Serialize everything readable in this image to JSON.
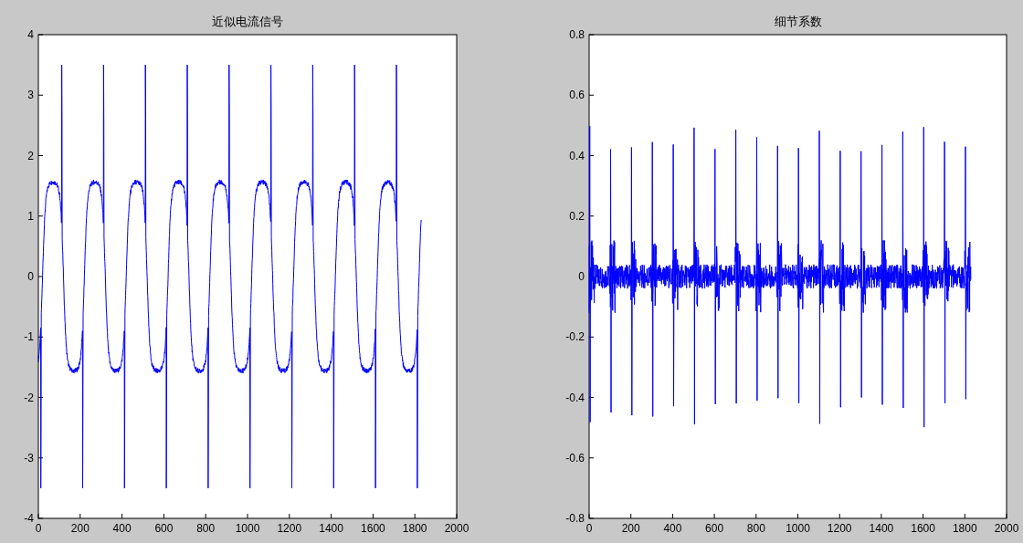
{
  "plots": [
    {
      "kind": "approx",
      "title": "近似电流信号",
      "xticks": [
        "0",
        "200",
        "400",
        "600",
        "800",
        "1000",
        "1200",
        "1400",
        "1600",
        "1800",
        "2000"
      ],
      "yticks": [
        "4",
        "3",
        "2",
        "1",
        "0",
        "-1",
        "-2",
        "-3",
        "-4"
      ]
    },
    {
      "kind": "detail",
      "title": "细节系数",
      "xticks": [
        "0",
        "200",
        "400",
        "600",
        "800",
        "1000",
        "1200",
        "1400",
        "1600",
        "1800",
        "2000"
      ],
      "yticks": [
        "0.8",
        "0.6",
        "0.4",
        "0.2",
        "0",
        "-0.2",
        "-0.4",
        "-0.6",
        "-0.8"
      ]
    }
  ]
}
